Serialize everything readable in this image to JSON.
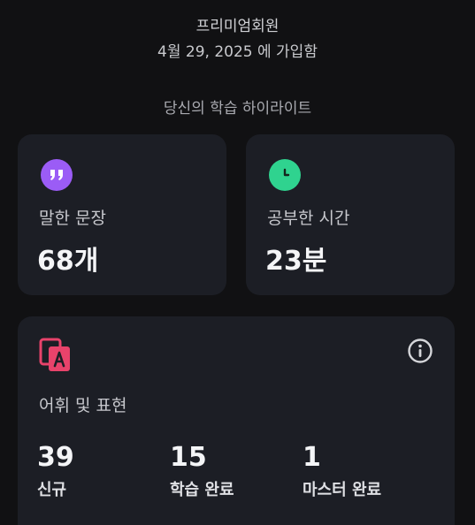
{
  "profile": {
    "membership": "프리미엄회원",
    "joined": "4월 29, 2025 에 가입함"
  },
  "highlights": {
    "title": "당신의 학습 하이라이트",
    "sentences": {
      "label": "말한 문장",
      "value": "68개"
    },
    "study_time": {
      "label": "공부한 시간",
      "value": "23분"
    },
    "vocab": {
      "label": "어휘 및 표현",
      "stats": [
        {
          "value": "39",
          "caption": "신규"
        },
        {
          "value": "15",
          "caption": "학습 완료"
        },
        {
          "value": "1",
          "caption": "마스터 완료"
        }
      ]
    }
  },
  "colors": {
    "background": "#111113",
    "card": "#1c1e25",
    "sentence_icon": "#9b5cf6",
    "time_icon": "#2fd38f",
    "vocab_icon": "#e8436b"
  },
  "icons": {
    "sentences": "quote-bubble-icon",
    "time": "clock-icon",
    "vocab": "flashcards-icon",
    "info": "info-icon"
  }
}
